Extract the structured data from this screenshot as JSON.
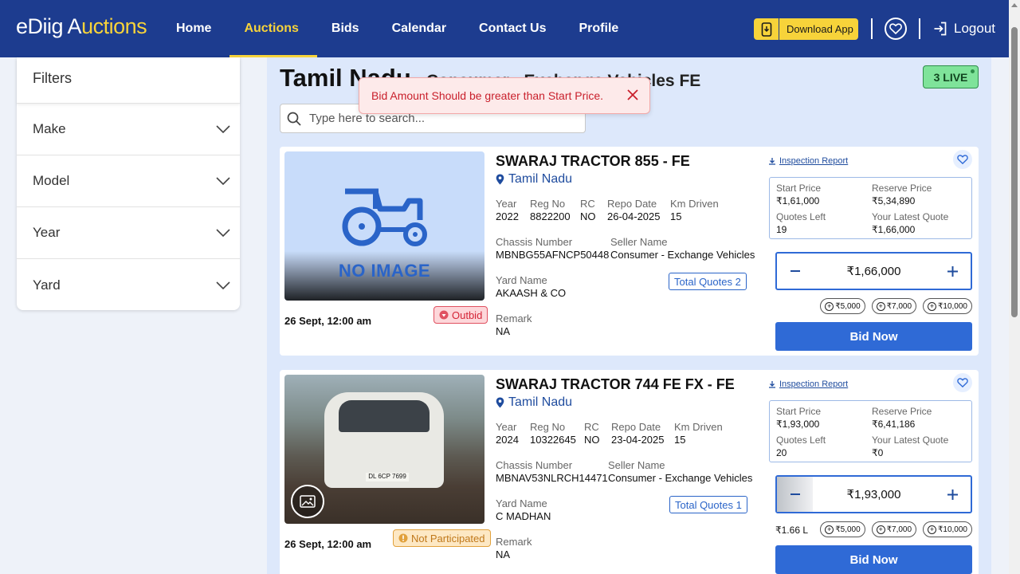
{
  "header": {
    "logo_part1": "eDiig A",
    "logo_part2": "uctions",
    "nav": [
      {
        "label": "Home"
      },
      {
        "label": "Auctions"
      },
      {
        "label": "Bids"
      },
      {
        "label": "Calendar"
      },
      {
        "label": "Contact Us"
      },
      {
        "label": "Profile"
      }
    ],
    "active_nav": "Auctions",
    "download_label": "Download App",
    "logout_label": "Logout"
  },
  "filters": {
    "title": "Filters",
    "items": [
      {
        "label": "Make"
      },
      {
        "label": "Model"
      },
      {
        "label": "Year"
      },
      {
        "label": "Yard"
      }
    ]
  },
  "main": {
    "state_title": "Tamil Nadu",
    "state_subtitle": "Consumer - Exchange Vehicles FE",
    "live_label": "3 LIVE",
    "search_placeholder": "Type here to search..."
  },
  "toast": {
    "message": "Bid Amount Should be greater than Start Price."
  },
  "labels": {
    "year": "Year",
    "reg_no": "Reg No",
    "rc": "RC",
    "repo_date": "Repo Date",
    "km_driven": "Km Driven",
    "chassis_number": "Chassis Number",
    "seller_name": "Seller Name",
    "yard_name": "Yard Name",
    "remark": "Remark",
    "total_quotes": "Total Quotes",
    "inspection_report": "Inspection Report",
    "start_price": "Start Price",
    "reserve_price": "Reserve Price",
    "quotes_left": "Quotes Left",
    "your_latest_quote": "Your Latest Quote",
    "bid_now": "Bid Now",
    "no_image": "NO IMAGE"
  },
  "vehicles": [
    {
      "title": "SWARAJ TRACTOR 855 - FE",
      "location": "Tamil Nadu",
      "year": "2022",
      "reg_no": "8822200",
      "rc": "NO",
      "repo_date": "26-04-2025",
      "km_driven": "15",
      "chassis_number": "MBNBG55AFNCP50448",
      "seller_name": "Consumer - Exchange Vehicles",
      "yard_name": "AKAASH & CO",
      "total_quotes": "2",
      "remark": "NA",
      "auction_date": "26 Sept, 12:00 am",
      "status": "Outbid",
      "status_color": "#d42436",
      "start_price": "₹1,61,000",
      "reserve_price": "₹5,34,890",
      "quotes_left": "19",
      "latest_quote": "₹1,66,000",
      "bid_amount": "₹1,66,000",
      "increments": [
        "₹5,000",
        "₹7,000",
        "₹10,000"
      ],
      "short_amount": "",
      "has_image": false
    },
    {
      "title": "SWARAJ TRACTOR 744 FE FX - FE",
      "location": "Tamil Nadu",
      "year": "2024",
      "reg_no": "10322645",
      "rc": "NO",
      "repo_date": "23-04-2025",
      "km_driven": "15",
      "chassis_number": "MBNAV53NLRCH14471",
      "seller_name": "Consumer - Exchange Vehicles",
      "yard_name": "C MADHAN",
      "total_quotes": "1",
      "remark": "NA",
      "auction_date": "26 Sept, 12:00 am",
      "status": "Not Participated",
      "status_color": "#c0781a",
      "start_price": "₹1,93,000",
      "reserve_price": "₹6,41,186",
      "quotes_left": "20",
      "latest_quote": "₹0",
      "bid_amount": "₹1,93,000",
      "increments": [
        "₹5,000",
        "₹7,000",
        "₹10,000"
      ],
      "short_amount": "₹1.66 L",
      "plate_text": "DL 6CP 7699",
      "has_image": true
    }
  ],
  "colors": {
    "header_bg": "#1d3c8f",
    "accent_yellow": "#f7d33a",
    "primary_blue": "#2f6ad6",
    "main_bg": "#dde8fb"
  }
}
